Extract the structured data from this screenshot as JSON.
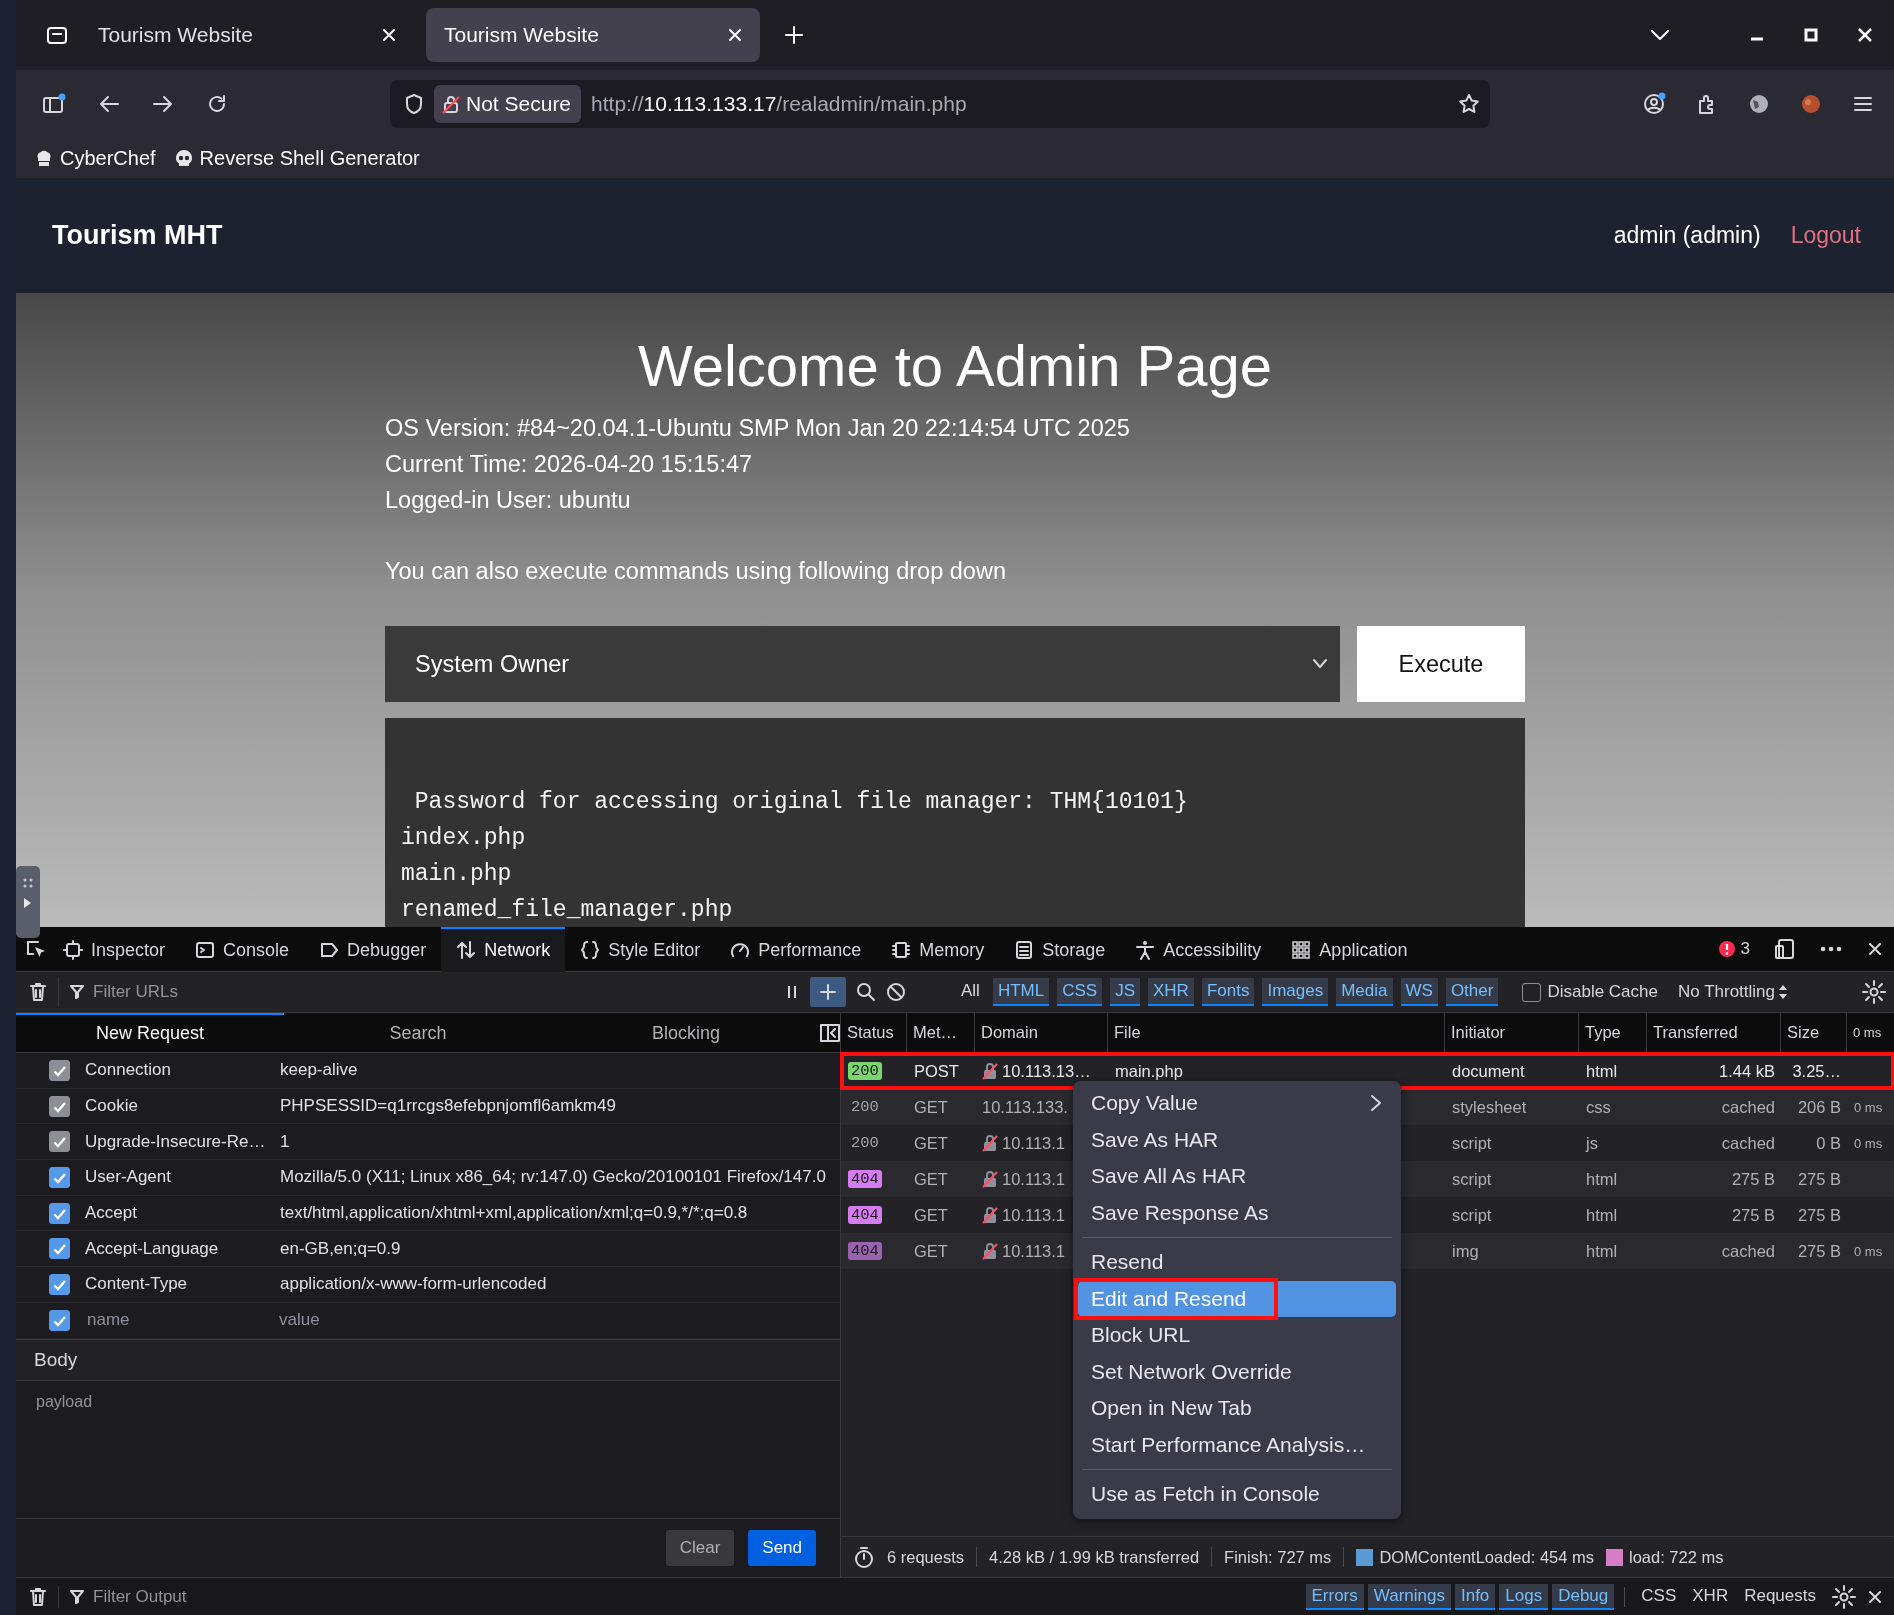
{
  "browser": {
    "tabs": [
      {
        "title": "Tourism Website",
        "selected": false
      },
      {
        "title": "Tourism Website",
        "selected": true
      }
    ],
    "security_label": "Not Secure",
    "url": {
      "scheme": "http://",
      "host": "10.113.133.17",
      "path": "/realadmin/main.php"
    },
    "bookmarks": [
      "CyberChef",
      "Reverse Shell Generator"
    ]
  },
  "page": {
    "brand": "Tourism MHT",
    "user": "admin (admin)",
    "logout": "Logout",
    "heading": "Welcome to Admin Page",
    "info": [
      "OS Version: #84~20.04.1-Ubuntu SMP Mon Jan 20 22:14:54 UTC 2025",
      "Current Time: 2026-04-20 15:15:47",
      "Logged-in User: ubuntu"
    ],
    "hint": "You can also execute commands using following drop down",
    "command": {
      "value": "System Owner"
    },
    "execute": "Execute",
    "output": [
      " Password for accessing original file manager: THM{10101}",
      "index.php",
      "main.php",
      "renamed_file_manager.php"
    ]
  },
  "devtools": {
    "tools": [
      {
        "label": "Inspector",
        "selected": false
      },
      {
        "label": "Console",
        "selected": false
      },
      {
        "label": "Debugger",
        "selected": false
      },
      {
        "label": "Network",
        "selected": true
      },
      {
        "label": "Style Editor",
        "selected": false
      },
      {
        "label": "Performance",
        "selected": false
      },
      {
        "label": "Memory",
        "selected": false
      },
      {
        "label": "Storage",
        "selected": false
      },
      {
        "label": "Accessibility",
        "selected": false
      },
      {
        "label": "Application",
        "selected": false
      }
    ],
    "error_count": "3",
    "url_filter": {
      "placeholder": "Filter URLs"
    },
    "type_filters": [
      {
        "label": "All",
        "selected": false
      },
      {
        "label": "HTML",
        "selected": true
      },
      {
        "label": "CSS",
        "selected": true
      },
      {
        "label": "JS",
        "selected": true
      },
      {
        "label": "XHR",
        "selected": true
      },
      {
        "label": "Fonts",
        "selected": true
      },
      {
        "label": "Images",
        "selected": true
      },
      {
        "label": "Media",
        "selected": true
      },
      {
        "label": "WS",
        "selected": true
      },
      {
        "label": "Other",
        "selected": true
      }
    ],
    "disable_cache": {
      "label": "Disable Cache",
      "checked": false
    },
    "throttling": "No Throttling",
    "request_tabs": [
      {
        "label": "New Request",
        "selected": true
      },
      {
        "label": "Search",
        "selected": false
      },
      {
        "label": "Blocking",
        "selected": false
      }
    ],
    "headers": [
      {
        "name": "Connection",
        "value": "keep-alive",
        "checked": true,
        "disabled": true
      },
      {
        "name": "Cookie",
        "value": "PHPSESSID=q1rrcgs8efebpnjomfl6amkm49",
        "checked": true,
        "disabled": true
      },
      {
        "name": "Upgrade-Insecure-Re…",
        "value": "1",
        "checked": true,
        "disabled": true
      },
      {
        "name": "User-Agent",
        "value": "Mozilla/5.0 (X11; Linux x86_64; rv:147.0) Gecko/20100101 Firefox/147.0",
        "checked": true,
        "disabled": false
      },
      {
        "name": "Accept",
        "value": "text/html,application/xhtml+xml,application/xml;q=0.9,*/*;q=0.8",
        "checked": true,
        "disabled": false
      },
      {
        "name": "Accept-Language",
        "value": "en-GB,en;q=0.9",
        "checked": true,
        "disabled": false
      },
      {
        "name": "Content-Type",
        "value": "application/x-www-form-urlencoded",
        "checked": true,
        "disabled": false
      }
    ],
    "new_header": {
      "checked": true,
      "name": {
        "placeholder": "name"
      },
      "value": {
        "placeholder": "value"
      }
    },
    "body": {
      "label": "Body",
      "placeholder": "payload"
    },
    "buttons": [
      {
        "label": "Clear",
        "kind": "secondary"
      },
      {
        "label": "Send",
        "kind": "primary"
      }
    ],
    "table": {
      "columns": [
        "Status",
        "Met…",
        "Domain",
        "File",
        "Initiator",
        "Type",
        "Transferred",
        "Size"
      ],
      "timeline_label": "0 ms",
      "rows": [
        {
          "status": "200",
          "color": "#7bd46e",
          "method": "POST",
          "insecure": true,
          "domain": "10.113.13…",
          "file": "main.php",
          "initiator": "document",
          "type": "html",
          "transferred": "1.44 kB",
          "size": "3.25…",
          "selected": true,
          "outlined": true
        },
        {
          "status": "200",
          "method": "GET",
          "insecure": false,
          "domain": "10.113.133.",
          "initiator": "stylesheet",
          "type": "css",
          "transferred": "cached",
          "size": "206 B",
          "timing": "0 ms",
          "selected": false,
          "outlined": false
        },
        {
          "status": "200",
          "method": "GET",
          "insecure": true,
          "domain": "10.113.1",
          "initiator": "script",
          "type": "js",
          "transferred": "cached",
          "size": "0 B",
          "timing": "0 ms",
          "selected": false,
          "outlined": false
        },
        {
          "status": "404",
          "color": "#d57cf2",
          "method": "GET",
          "insecure": true,
          "domain": "10.113.1",
          "initiator": "script",
          "type": "html",
          "transferred": "275 B",
          "size": "275 B",
          "selected": false,
          "outlined": false
        },
        {
          "status": "404",
          "color": "#d57cf2",
          "method": "GET",
          "insecure": true,
          "domain": "10.113.1",
          "initiator": "script",
          "type": "html",
          "transferred": "275 B",
          "size": "275 B",
          "selected": false,
          "outlined": false
        },
        {
          "status": "404",
          "color": "#9a62b0",
          "method": "GET",
          "insecure": true,
          "domain": "10.113.1",
          "initiator": "img",
          "type": "html",
          "transferred": "cached",
          "size": "275 B",
          "timing": "0 ms",
          "selected": false,
          "outlined": false
        }
      ]
    },
    "context_menu": {
      "groups": [
        [
          {
            "label": "Copy Value",
            "submenu": true,
            "selected": false,
            "outlined": false
          },
          {
            "label": "Save As HAR",
            "submenu": false,
            "selected": false,
            "outlined": false
          },
          {
            "label": "Save All As HAR",
            "submenu": false,
            "selected": false,
            "outlined": false
          },
          {
            "label": "Save Response As",
            "submenu": false,
            "selected": false,
            "outlined": false
          }
        ],
        [
          {
            "label": "Resend",
            "submenu": false,
            "selected": false,
            "outlined": false
          },
          {
            "label": "Edit and Resend",
            "submenu": false,
            "selected": true,
            "outlined": true
          },
          {
            "label": "Block URL",
            "submenu": false,
            "selected": false,
            "outlined": false
          },
          {
            "label": "Set Network Override",
            "submenu": false,
            "selected": false,
            "outlined": false
          },
          {
            "label": "Open in New Tab",
            "submenu": false,
            "selected": false,
            "outlined": false
          },
          {
            "label": "Start Performance Analysis…",
            "submenu": false,
            "selected": false,
            "outlined": false
          }
        ],
        [
          {
            "label": "Use as Fetch in Console",
            "submenu": false,
            "selected": false,
            "outlined": false
          }
        ]
      ]
    },
    "summary": {
      "requests": "6 requests",
      "size": "4.28 kB / 1.99 kB transferred",
      "finish": "Finish: 727 ms",
      "markers": [
        {
          "label": "DOMContentLoaded: 454 ms",
          "color": "#5b9bd5"
        },
        {
          "label": "load: 722 ms",
          "color": "#d47fc4"
        }
      ]
    },
    "console": {
      "filter": {
        "placeholder": "Filter Output"
      },
      "levels": [
        {
          "label": "Errors",
          "selected": true
        },
        {
          "label": "Warnings",
          "selected": true
        },
        {
          "label": "Info",
          "selected": true
        },
        {
          "label": "Logs",
          "selected": true
        },
        {
          "label": "Debug",
          "selected": true
        }
      ],
      "kinds": [
        {
          "label": "CSS",
          "selected": false
        },
        {
          "label": "XHR",
          "selected": false
        },
        {
          "label": "Requests",
          "selected": false
        }
      ]
    }
  }
}
